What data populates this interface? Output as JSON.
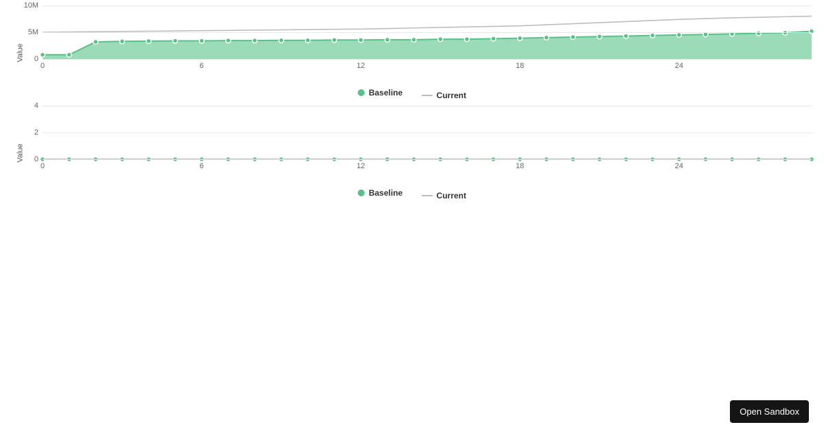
{
  "button": {
    "open_sandbox": "Open Sandbox"
  },
  "colors": {
    "baseline_stroke": "#58c088",
    "baseline_fill": "rgba(121,207,160,0.75)",
    "baseline_dot_stroke": "#ffffff",
    "current_stroke": "#bdbdbd"
  },
  "legend": {
    "baseline": "Baseline",
    "current": "Current"
  },
  "chart_data": [
    {
      "type": "area",
      "ylabel": "Value",
      "xlabel": "",
      "ylim": [
        0,
        10000000
      ],
      "ytick_values": [
        0,
        5000000,
        10000000
      ],
      "ytick_labels": [
        "0",
        "5M",
        "10M"
      ],
      "x": [
        0,
        1,
        2,
        3,
        4,
        5,
        6,
        7,
        8,
        9,
        10,
        11,
        12,
        13,
        14,
        15,
        16,
        17,
        18,
        19,
        20,
        21,
        22,
        23,
        24,
        25,
        26,
        27,
        28,
        29
      ],
      "xtick_values": [
        0,
        6,
        12,
        18,
        24
      ],
      "xtick_labels": [
        "0",
        "6",
        "12",
        "18",
        "24"
      ],
      "series": [
        {
          "name": "Baseline",
          "kind": "area_with_dots",
          "values": [
            800000,
            800000,
            3200000,
            3300000,
            3350000,
            3400000,
            3400000,
            3450000,
            3450000,
            3500000,
            3500000,
            3550000,
            3550000,
            3600000,
            3600000,
            3700000,
            3700000,
            3800000,
            3900000,
            4000000,
            4100000,
            4200000,
            4300000,
            4400000,
            4500000,
            4600000,
            4700000,
            4800000,
            4900000,
            5200000
          ]
        },
        {
          "name": "Current",
          "kind": "line",
          "values": [
            5000000,
            5050000,
            5100000,
            5150000,
            5200000,
            5250000,
            5300000,
            5350000,
            5400000,
            5450000,
            5500000,
            5550000,
            5600000,
            5700000,
            5800000,
            5900000,
            6000000,
            6100000,
            6200000,
            6400000,
            6600000,
            6800000,
            7000000,
            7200000,
            7400000,
            7550000,
            7700000,
            7800000,
            7900000,
            8000000
          ]
        }
      ]
    },
    {
      "type": "line",
      "ylabel": "Value",
      "xlabel": "",
      "ylim": [
        0,
        4
      ],
      "ytick_values": [
        0,
        2,
        4
      ],
      "ytick_labels": [
        "0",
        "2",
        "4"
      ],
      "x": [
        0,
        1,
        2,
        3,
        4,
        5,
        6,
        7,
        8,
        9,
        10,
        11,
        12,
        13,
        14,
        15,
        16,
        17,
        18,
        19,
        20,
        21,
        22,
        23,
        24,
        25,
        26,
        27,
        28,
        29
      ],
      "xtick_values": [
        0,
        6,
        12,
        18,
        24
      ],
      "xtick_labels": [
        "0",
        "6",
        "12",
        "18",
        "24"
      ],
      "series": [
        {
          "name": "Baseline",
          "kind": "line_with_dots",
          "values": [
            0,
            0,
            0,
            0,
            0,
            0,
            0,
            0,
            0,
            0,
            0,
            0,
            0,
            0,
            0,
            0,
            0,
            0,
            0,
            0,
            0,
            0,
            0,
            0,
            0,
            0,
            0,
            0,
            0,
            0
          ]
        },
        {
          "name": "Current",
          "kind": "line",
          "values": [
            0,
            0,
            0,
            0,
            0,
            0,
            0,
            0,
            0,
            0,
            0,
            0,
            0,
            0,
            0,
            0,
            0,
            0,
            0,
            0,
            0,
            0,
            0,
            0,
            0,
            0,
            0,
            0,
            0,
            0
          ]
        }
      ]
    }
  ]
}
